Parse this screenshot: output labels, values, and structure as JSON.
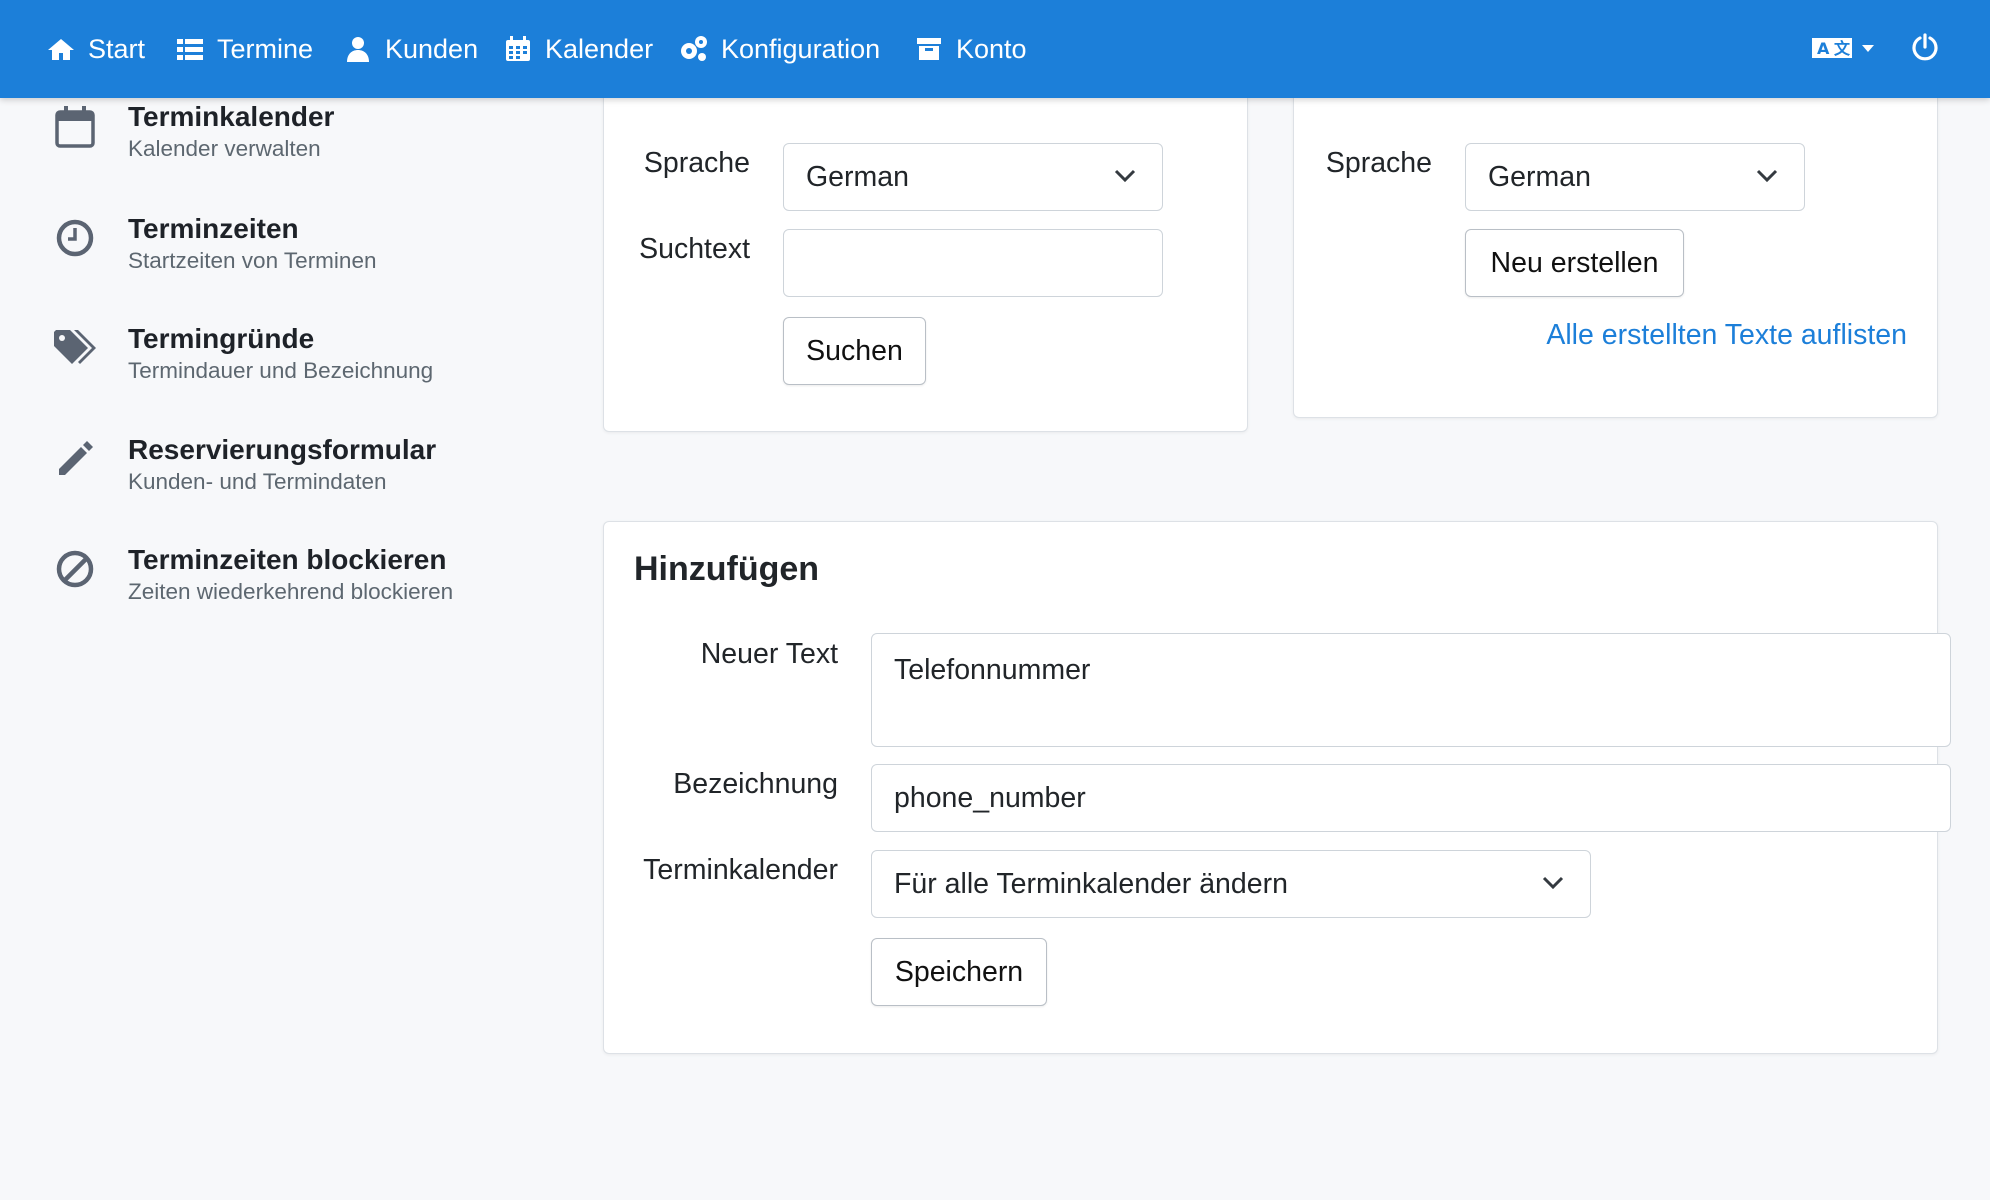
{
  "nav": {
    "items": [
      {
        "label": "Start",
        "icon": "home-icon"
      },
      {
        "label": "Termine",
        "icon": "list-icon"
      },
      {
        "label": "Kunden",
        "icon": "user-icon"
      },
      {
        "label": "Kalender",
        "icon": "calendar-icon"
      },
      {
        "label": "Konfiguration",
        "icon": "cogs-icon"
      },
      {
        "label": "Konto",
        "icon": "archive-icon"
      }
    ],
    "right": {
      "language_icon": "translate-icon",
      "logout_icon": "power-icon"
    },
    "color": "#1c7fd9"
  },
  "sidebar": {
    "items": [
      {
        "title": "Terminkalender",
        "subtitle": "Kalender verwalten",
        "icon": "calendar-icon"
      },
      {
        "title": "Terminzeiten",
        "subtitle": "Startzeiten von Terminen",
        "icon": "clock-icon"
      },
      {
        "title": "Termingründe",
        "subtitle": "Termindauer und Bezeichnung",
        "icon": "tags-icon"
      },
      {
        "title": "Reservierungsformular",
        "subtitle": "Kunden- und Termindaten",
        "icon": "pencil-icon"
      },
      {
        "title": "Terminzeiten blockieren",
        "subtitle": "Zeiten wiederkehrend blockieren",
        "icon": "ban-icon"
      }
    ]
  },
  "search_card": {
    "language_label": "Sprache",
    "language_value": "German",
    "search_label": "Suchtext",
    "search_value": "",
    "search_button": "Suchen"
  },
  "create_card": {
    "language_label": "Sprache",
    "language_value": "German",
    "create_button": "Neu erstellen",
    "list_link": "Alle erstellten Texte auflisten"
  },
  "add_card": {
    "title": "Hinzufügen",
    "new_text_label": "Neuer Text",
    "new_text_value": "Telefonnummer",
    "name_label": "Bezeichnung",
    "name_value": "phone_number",
    "calendar_label": "Terminkalender",
    "calendar_value": "Für alle Terminkalender ändern",
    "save_button": "Speichern"
  }
}
